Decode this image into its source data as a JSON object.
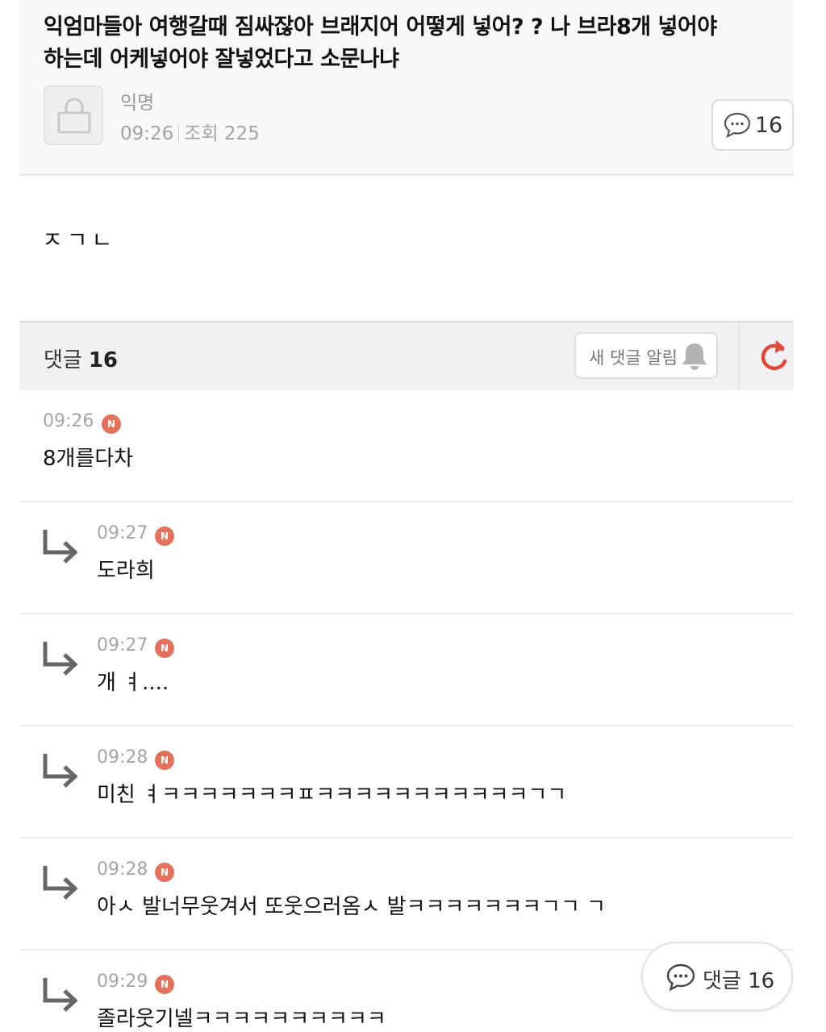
{
  "post": {
    "title": "익엄마들아 여행갈때 짐싸잖아 브래지어 어떻게 넣어? ? 나 브라8개 넣어야하는데 어케넣어야 잘넣었다고 소문나냐",
    "author": "익명",
    "time": "09:26",
    "views_label": "조회 225",
    "comment_count": "16",
    "body": "ㅈㄱㄴ"
  },
  "comments_section": {
    "title": "댓글",
    "count": "16",
    "notify_label": "새 댓글 알림"
  },
  "comments": [
    {
      "time": "09:26",
      "badge": "N",
      "text": "8개를다차",
      "reply": false
    },
    {
      "time": "09:27",
      "badge": "N",
      "text": "도라희",
      "reply": true
    },
    {
      "time": "09:27",
      "badge": "N",
      "text": "개 ㅕ....",
      "reply": true
    },
    {
      "time": "09:28",
      "badge": "N",
      "text": "미친 ㅕㅋㅋㅋㅋㅋㅋㅋㅍㅋㅋㅋㅋㅋㅋㅋㅋㅋㅋㅋㄱㄱ",
      "reply": true
    },
    {
      "time": "09:28",
      "badge": "N",
      "text": "아ㅅ 발너무웃겨서 또웃으러옴ㅅ 발ㅋㅋㅋㅋㅋㅋㅋㄱㄱ ㄱ",
      "reply": true
    },
    {
      "time": "09:29",
      "badge": "N",
      "text": "졸라웃기넬ㅋㅋㅋㅋㅋㅋㅋㅋㅋㅋ",
      "reply": true
    }
  ],
  "floating_button": {
    "label": "댓글 16"
  },
  "colors": {
    "badge": "#e4715b",
    "refresh": "#e04a3a",
    "header_bg": "#f8f8fa",
    "bar_bg": "#f1f1f3"
  },
  "icons": [
    "lock-icon",
    "comment-bubble-icon",
    "bell-icon",
    "refresh-icon",
    "reply-arrow-icon"
  ]
}
